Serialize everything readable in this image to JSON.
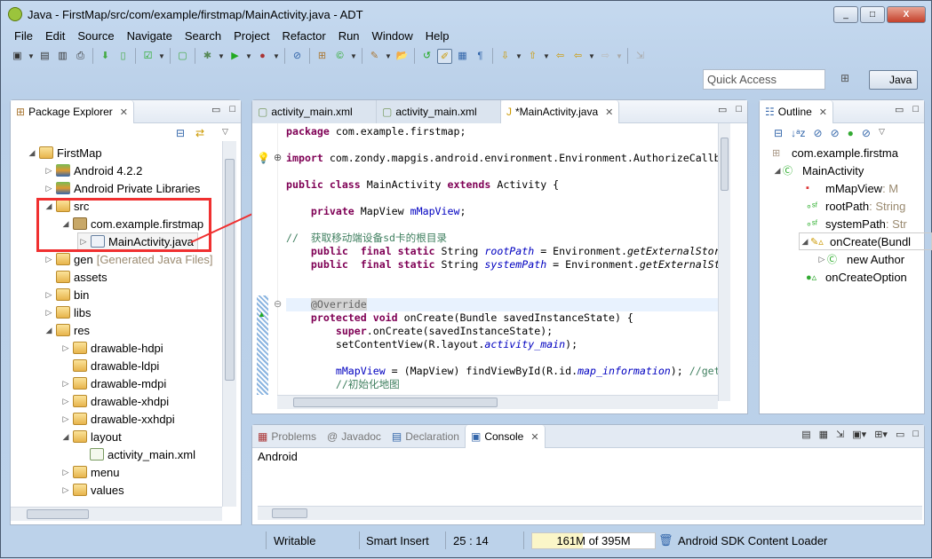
{
  "window": {
    "title": "Java - FirstMap/src/com/example/firstmap/MainActivity.java - ADT",
    "minimize": "_",
    "maximize": "□",
    "close": "X"
  },
  "menu": [
    "File",
    "Edit",
    "Source",
    "Navigate",
    "Search",
    "Project",
    "Refactor",
    "Run",
    "Window",
    "Help"
  ],
  "quick_access": {
    "placeholder": "Quick Access"
  },
  "perspective": {
    "label": "Java"
  },
  "package_explorer": {
    "title": "Package Explorer",
    "tree": [
      {
        "label": "FirstMap",
        "depth": 0,
        "arrow": "open",
        "icon": "project"
      },
      {
        "label": "Android 4.2.2",
        "depth": 1,
        "arrow": "closed",
        "icon": "library"
      },
      {
        "label": "Android Private Libraries",
        "depth": 1,
        "arrow": "closed",
        "icon": "library"
      },
      {
        "label": "src",
        "depth": 1,
        "arrow": "open",
        "icon": "source-folder"
      },
      {
        "label": "com.example.firstmap",
        "depth": 2,
        "arrow": "open",
        "icon": "package"
      },
      {
        "label": "MainActivity.java",
        "depth": 3,
        "arrow": "closed",
        "icon": "java-file"
      },
      {
        "label": "gen",
        "suffix": "[Generated Java Files]",
        "depth": 1,
        "arrow": "closed",
        "icon": "source-folder"
      },
      {
        "label": "assets",
        "depth": 1,
        "arrow": "none",
        "icon": "folder"
      },
      {
        "label": "bin",
        "depth": 1,
        "arrow": "closed",
        "icon": "folder"
      },
      {
        "label": "libs",
        "depth": 1,
        "arrow": "closed",
        "icon": "folder"
      },
      {
        "label": "res",
        "depth": 1,
        "arrow": "open",
        "icon": "folder"
      },
      {
        "label": "drawable-hdpi",
        "depth": 2,
        "arrow": "closed",
        "icon": "folder"
      },
      {
        "label": "drawable-ldpi",
        "depth": 2,
        "arrow": "none",
        "icon": "folder"
      },
      {
        "label": "drawable-mdpi",
        "depth": 2,
        "arrow": "closed",
        "icon": "folder"
      },
      {
        "label": "drawable-xhdpi",
        "depth": 2,
        "arrow": "closed",
        "icon": "folder"
      },
      {
        "label": "drawable-xxhdpi",
        "depth": 2,
        "arrow": "closed",
        "icon": "folder"
      },
      {
        "label": "layout",
        "depth": 2,
        "arrow": "open",
        "icon": "folder"
      },
      {
        "label": "activity_main.xml",
        "depth": 3,
        "arrow": "none",
        "icon": "xml-file"
      },
      {
        "label": "menu",
        "depth": 2,
        "arrow": "closed",
        "icon": "folder"
      },
      {
        "label": "values",
        "depth": 2,
        "arrow": "closed",
        "icon": "folder"
      }
    ]
  },
  "editor": {
    "tabs": [
      {
        "label": "activity_main.xml",
        "active": false
      },
      {
        "label": "activity_main.xml",
        "active": false
      },
      {
        "label": "*MainActivity.java",
        "active": true
      }
    ],
    "lines": [
      [
        [
          "package",
          "kw"
        ],
        [
          " com.example.firstmap;",
          ""
        ]
      ],
      [],
      [
        [
          "import",
          "kw"
        ],
        [
          " com.zondy.mapgis.android.environment.Environment.AuthorizeCallb",
          ""
        ]
      ],
      [],
      [
        [
          "public class",
          "kw"
        ],
        [
          " MainActivity ",
          ""
        ],
        [
          "extends",
          "kw"
        ],
        [
          " Activity {",
          ""
        ]
      ],
      [],
      [
        [
          "    ",
          ""
        ],
        [
          "private",
          "kw"
        ],
        [
          " MapView ",
          ""
        ],
        [
          "mMapView",
          "fd"
        ],
        [
          ";",
          ""
        ]
      ],
      [],
      [
        [
          "//  获取移动端设备sd卡的根目录",
          "cm"
        ]
      ],
      [
        [
          "    ",
          ""
        ],
        [
          "public",
          "kw"
        ],
        [
          "  ",
          ""
        ],
        [
          "final static",
          "kw"
        ],
        [
          " String ",
          ""
        ],
        [
          "rootPath",
          "sf"
        ],
        [
          " = Environment.",
          ""
        ],
        [
          "getExternalStor",
          "st"
        ]
      ],
      [
        [
          "    ",
          ""
        ],
        [
          "public",
          "kw"
        ],
        [
          "  ",
          ""
        ],
        [
          "final static",
          "kw"
        ],
        [
          " String ",
          ""
        ],
        [
          "systemPath",
          "sf"
        ],
        [
          " = Environment.",
          ""
        ],
        [
          "getExternalSt",
          "st"
        ]
      ],
      [],
      [],
      [
        [
          "    ",
          ""
        ],
        [
          "@Override",
          "an"
        ]
      ],
      [
        [
          "    ",
          ""
        ],
        [
          "protected void",
          "kw"
        ],
        [
          " onCreate(Bundle savedInstanceState) {",
          ""
        ]
      ],
      [
        [
          "        ",
          ""
        ],
        [
          "super",
          "kw"
        ],
        [
          ".onCreate(savedInstanceState);",
          ""
        ]
      ],
      [
        [
          "        setContentView(R.layout.",
          ""
        ],
        [
          "activity_main",
          "sf"
        ],
        [
          ");",
          ""
        ]
      ],
      [],
      [
        [
          "        ",
          ""
        ],
        [
          "mMapView",
          "fd"
        ],
        [
          " = (MapView) findViewById(R.id.",
          ""
        ],
        [
          "map_information",
          "sf"
        ],
        [
          "); ",
          ""
        ],
        [
          "//get",
          "cm"
        ]
      ],
      [
        [
          "        ",
          ""
        ],
        [
          "//初始化地图",
          "cm"
        ]
      ]
    ]
  },
  "outline": {
    "title": "Outline",
    "items": [
      {
        "label": "com.example.firstma",
        "depth": 1,
        "icon": "package"
      },
      {
        "label": "MainActivity",
        "depth": 1,
        "arrow": "open",
        "icon": "class"
      },
      {
        "label": "mMapView",
        "type": " : M",
        "depth": 2,
        "icon": "private-field"
      },
      {
        "label": "rootPath",
        "type": " : String",
        "depth": 2,
        "icon": "static-final-field"
      },
      {
        "label": "systemPath",
        "type": " : Str",
        "depth": 2,
        "icon": "static-final-field"
      },
      {
        "label": "onCreate(Bundl",
        "depth": 2,
        "arrow": "open",
        "icon": "method-override"
      },
      {
        "label": "new Author",
        "depth": 3,
        "arrow": "closed",
        "icon": "anonymous-class"
      },
      {
        "label": "onCreateOption",
        "depth": 2,
        "icon": "public-method"
      }
    ]
  },
  "console": {
    "tabs": [
      {
        "label": "Problems"
      },
      {
        "label": "Javadoc"
      },
      {
        "label": "Declaration"
      },
      {
        "label": "Console",
        "active": true
      }
    ],
    "content": "Android"
  },
  "status": {
    "mode": "Writable",
    "insert": "Smart Insert",
    "position": "25 : 14",
    "heap": "161M of 395M",
    "heap_used_fraction": 0.41,
    "task": "Android SDK Content Loader"
  }
}
